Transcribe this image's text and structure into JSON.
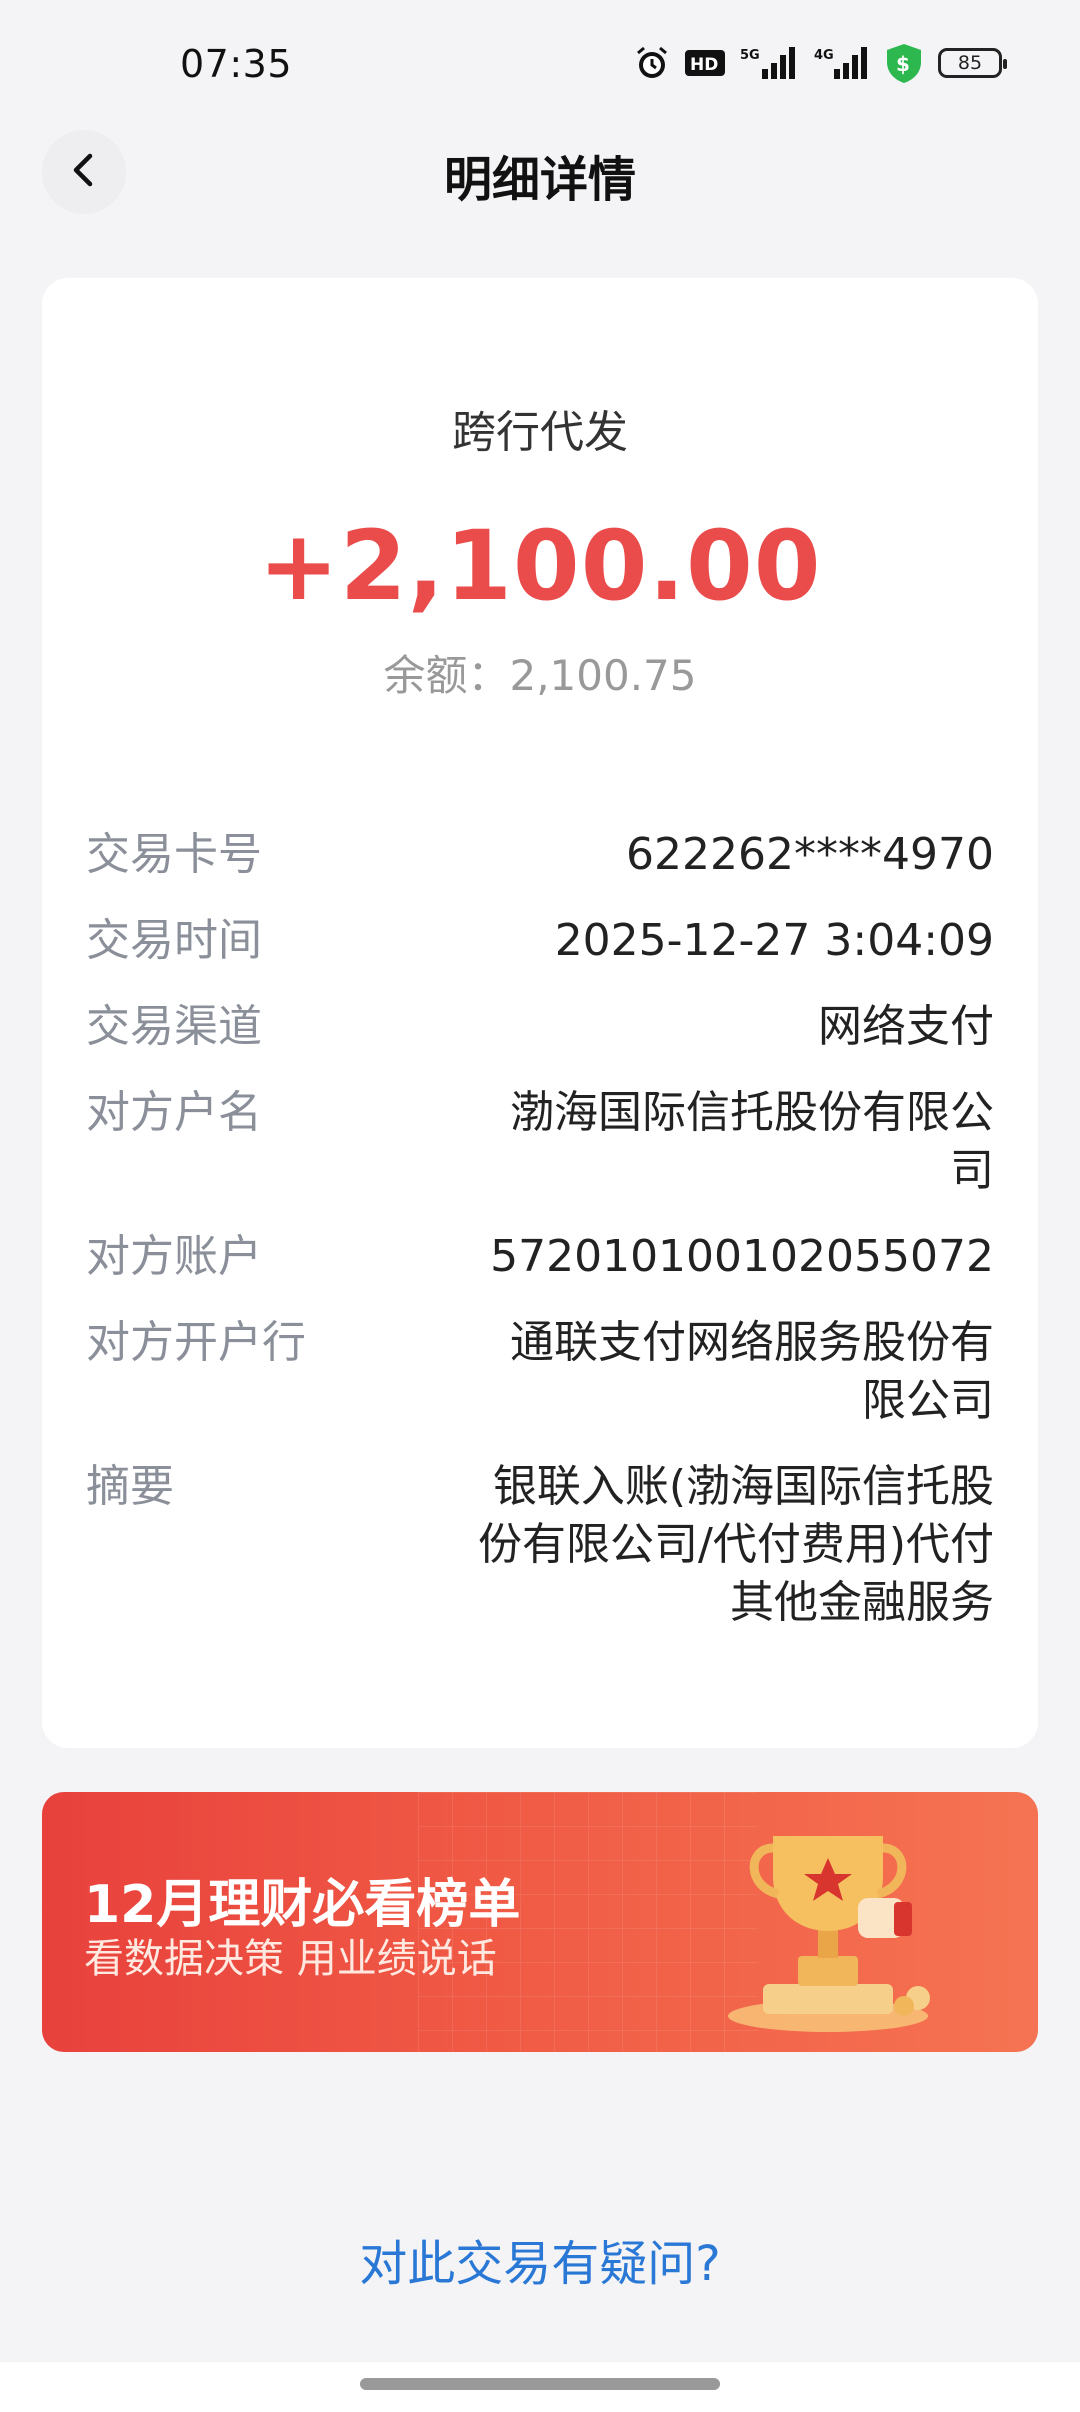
{
  "status_bar": {
    "time": "07:35",
    "battery": "85",
    "icons": [
      "alarm-icon",
      "hd-icon",
      "5g-signal-icon",
      "4g-signal-icon",
      "shield-dollar-icon",
      "battery-icon"
    ]
  },
  "header": {
    "title": "明细详情",
    "back_icon": "chevron-left-icon"
  },
  "transaction": {
    "type": "跨行代发",
    "amount": "+2,100.00",
    "amount_color": "#ea4c4c",
    "balance": "余额：2,100.75"
  },
  "details": [
    {
      "label": "交易卡号",
      "value": "622262****4970"
    },
    {
      "label": "交易时间",
      "value": "2025-12-27 3:04:09"
    },
    {
      "label": "交易渠道",
      "value": "网络支付"
    },
    {
      "label": "对方户名",
      "value": "渤海国际信托股份有限公司"
    },
    {
      "label": "对方账户",
      "value": "572010100102055072"
    },
    {
      "label": "对方开户行",
      "value": "通联支付网络服务股份有限公司"
    },
    {
      "label": "摘要",
      "value": "银联入账(渤海国际信托股份有限公司/代付费用)代付其他金融服务"
    }
  ],
  "banner": {
    "title": "12月理财必看榜单",
    "subtitle": "看数据决策 用业绩说话",
    "icon": "trophy-icon"
  },
  "question_link": "对此交易有疑问?",
  "colors": {
    "accent_red": "#ea4c4c",
    "link_blue": "#2a78d6",
    "label_gray": "#8a8f99"
  }
}
